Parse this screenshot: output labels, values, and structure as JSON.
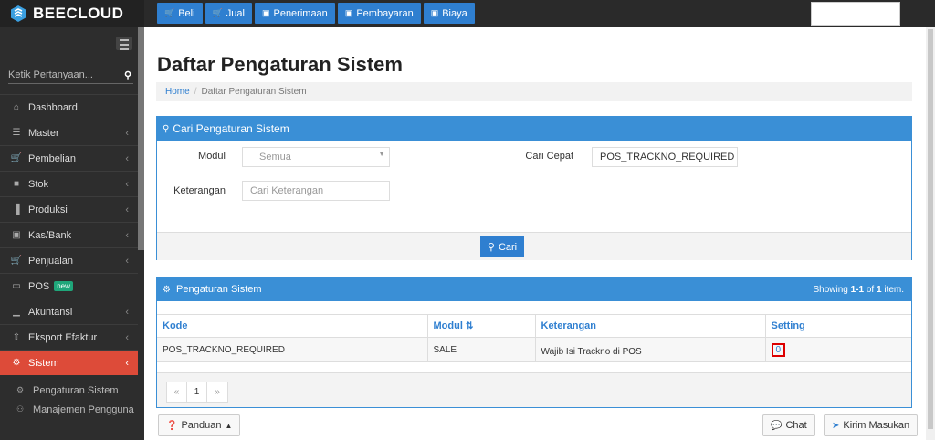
{
  "brand": {
    "name": "BEECLOUD"
  },
  "topnav": [
    {
      "icon": "cart-icon",
      "label": "Beli"
    },
    {
      "icon": "cart-icon",
      "label": "Jual"
    },
    {
      "icon": "money-icon",
      "label": "Penerimaan"
    },
    {
      "icon": "money-icon",
      "label": "Pembayaran"
    },
    {
      "icon": "money-icon",
      "label": "Biaya"
    }
  ],
  "sidebar": {
    "search_placeholder": "Ketik Pertanyaan...",
    "items": [
      {
        "label": "Dashboard",
        "icon": "home-icon",
        "has_chevron": false
      },
      {
        "label": "Master",
        "icon": "list-icon",
        "has_chevron": true
      },
      {
        "label": "Pembelian",
        "icon": "cart-icon",
        "has_chevron": true
      },
      {
        "label": "Stok",
        "icon": "box-icon",
        "has_chevron": true
      },
      {
        "label": "Produksi",
        "icon": "factory-icon",
        "has_chevron": true
      },
      {
        "label": "Kas/Bank",
        "icon": "money-icon",
        "has_chevron": true
      },
      {
        "label": "Penjualan",
        "icon": "cart-icon",
        "has_chevron": true
      },
      {
        "label": "POS",
        "icon": "monitor-icon",
        "badge": "new",
        "has_chevron": false
      },
      {
        "label": "Akuntansi",
        "icon": "chart-icon",
        "has_chevron": true
      },
      {
        "label": "Eksport Efaktur",
        "icon": "export-icon",
        "has_chevron": true
      },
      {
        "label": "Sistem",
        "icon": "gears-icon",
        "has_chevron": true,
        "active": true
      }
    ],
    "subitems": [
      {
        "label": "Pengaturan Sistem",
        "icon": "gear-icon"
      },
      {
        "label": "Manajemen Pengguna",
        "icon": "users-icon"
      }
    ]
  },
  "page": {
    "title": "Daftar Pengaturan Sistem",
    "breadcrumb_home": "Home",
    "breadcrumb_current": "Daftar Pengaturan Sistem"
  },
  "search_panel": {
    "title": "Cari Pengaturan Sistem",
    "modul_label": "Modul",
    "modul_value": "Semua",
    "keterangan_label": "Keterangan",
    "keterangan_placeholder": "Cari Keterangan",
    "cari_cepat_label": "Cari Cepat",
    "cari_cepat_value": "POS_TRACKNO_REQUIRED",
    "button_label": "Cari"
  },
  "results_panel": {
    "title": "Pengaturan Sistem",
    "showing_prefix": "Showing ",
    "showing_range": "1-1",
    "showing_mid": " of ",
    "showing_total": "1",
    "showing_suffix": " item.",
    "columns": [
      "Kode",
      "Modul",
      "Keterangan",
      "Setting"
    ],
    "rows": [
      {
        "kode": "POS_TRACKNO_REQUIRED",
        "modul": "SALE",
        "keterangan": "Wajib Isi Trackno di POS",
        "setting": "0"
      }
    ],
    "pager": [
      "«",
      "1",
      "»"
    ]
  },
  "footer": {
    "panduan": "Panduan",
    "chat": "Chat",
    "kirim": "Kirim Masukan"
  },
  "colors": {
    "accent": "#2f7fd0",
    "active_menu": "#dd4b39",
    "highlight_box": "#dd0000"
  }
}
